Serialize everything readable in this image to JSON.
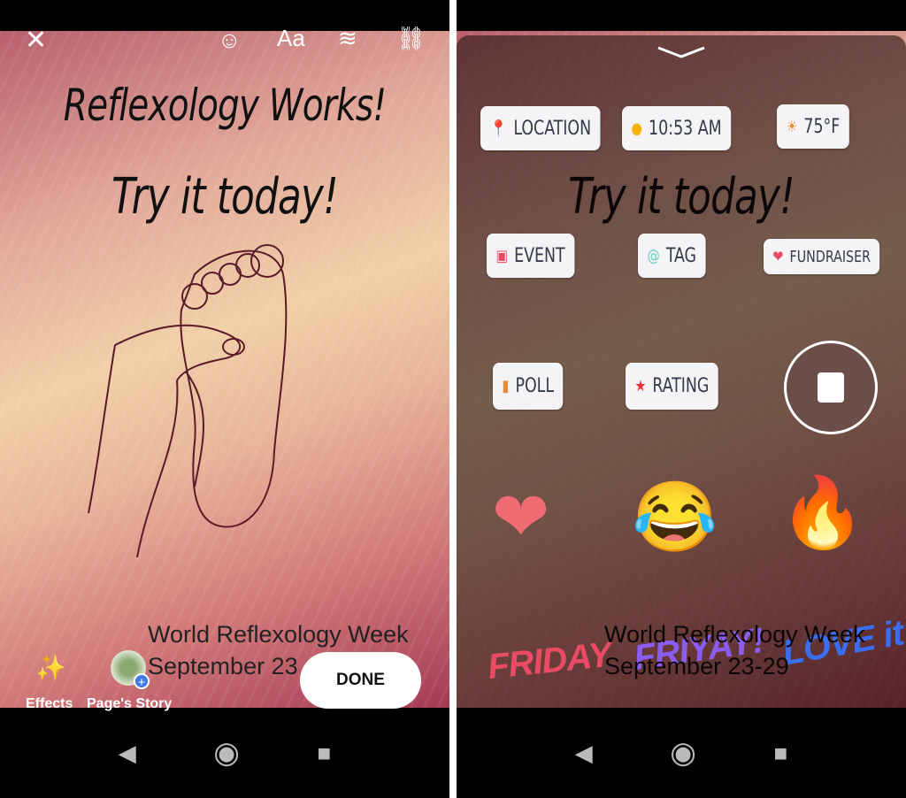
{
  "left": {
    "toolbar": {
      "close_icon": "close-icon",
      "sticker_icon": "sticker-icon",
      "text_label": "Aa",
      "draw_icon": "draw-icon",
      "link_icon": "link-icon"
    },
    "story": {
      "headline1": "Reflexology Works!",
      "headline2": "Try it today!",
      "caption1": "World Reflexology Week",
      "caption2": "September 23"
    },
    "bottom": {
      "effects_label": "Effects",
      "pages_story_label": "Page's Story",
      "done_label": "DONE"
    }
  },
  "right": {
    "stickers": [
      {
        "label": "LOCATION",
        "icon": "location-pin-icon",
        "color": "#3db4e6"
      },
      {
        "label": "10:53 AM",
        "icon": "clock-icon",
        "color": "#f5b400"
      },
      {
        "label": "75°F",
        "icon": "sun-icon",
        "color": "#f08a30"
      },
      {
        "label": "EVENT",
        "icon": "calendar-icon",
        "color": "#e84b63"
      },
      {
        "label": "TAG",
        "icon": "at-icon",
        "color": "#5fcfb5"
      },
      {
        "label": "FUNDRAISER",
        "icon": "fundraiser-icon",
        "color": "#e84b63"
      },
      {
        "label": "POLL",
        "icon": "bar-chart-icon",
        "color": "#f08a30"
      },
      {
        "label": "RATING",
        "icon": "star-icon",
        "color": "#e8323c"
      }
    ],
    "gif_stickers": [
      "FRIDAY",
      "FRIYAY!",
      "LOVE it"
    ],
    "background_caption1": "World Reflexology Week",
    "background_caption2": "September 23-29",
    "background_headline2": "Try it today!"
  },
  "nav": {
    "back": "◀",
    "home": "◉",
    "recents": "■"
  }
}
